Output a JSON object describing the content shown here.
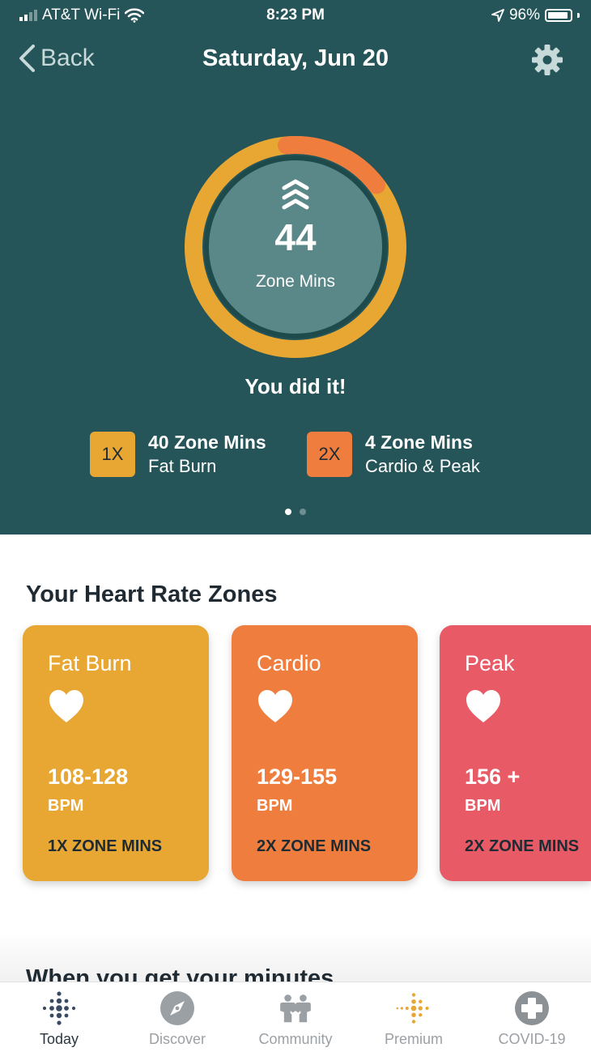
{
  "status_bar": {
    "carrier": "AT&T Wi-Fi",
    "time": "8:23 PM",
    "battery": "96%"
  },
  "nav": {
    "back_label": "Back",
    "title": "Saturday, Jun 20"
  },
  "summary": {
    "zone_minutes": "44",
    "zone_minutes_label": "Zone Mins",
    "goal_message": "You did it!",
    "fat_burn_fraction_of_ring": 0.84,
    "cardio_peak_fraction_of_ring": 0.16,
    "legend": [
      {
        "badge": "1X",
        "minutes": "40 Zone Mins",
        "zone": "Fat Burn",
        "color": "#e8a733"
      },
      {
        "badge": "2X",
        "minutes": "4 Zone Mins",
        "zone": "Cardio & Peak",
        "color": "#ef7d3e"
      }
    ],
    "page_dots": {
      "count": 2,
      "active": 0
    }
  },
  "zones_section": {
    "title": "Your Heart Rate Zones",
    "cards": [
      {
        "name": "Fat Burn",
        "range": "108-128",
        "unit": "BPM",
        "multiplier": "1X ZONE MINS",
        "color": "#e8a733"
      },
      {
        "name": "Cardio",
        "range": "129-155",
        "unit": "BPM",
        "multiplier": "2X ZONE MINS",
        "color": "#ef7d3e"
      },
      {
        "name": "Peak",
        "range": "156 +",
        "unit": "BPM",
        "multiplier": "2X ZONE MINS",
        "color": "#e85a66"
      }
    ]
  },
  "next_section": {
    "title": "When you get your minutes"
  },
  "tabs": [
    {
      "label": "Today",
      "icon": "fitbit-dots-icon",
      "active": true
    },
    {
      "label": "Discover",
      "icon": "compass-icon",
      "active": false
    },
    {
      "label": "Community",
      "icon": "community-icon",
      "active": false
    },
    {
      "label": "Premium",
      "icon": "premium-dots-icon",
      "active": false
    },
    {
      "label": "COVID-19",
      "icon": "plus-circle-icon",
      "active": false
    }
  ],
  "colors": {
    "header_bg": "#255558",
    "ring_fat_burn": "#e8a733",
    "ring_cardio": "#ef7d3e",
    "inner_circle": "#5a8788"
  }
}
